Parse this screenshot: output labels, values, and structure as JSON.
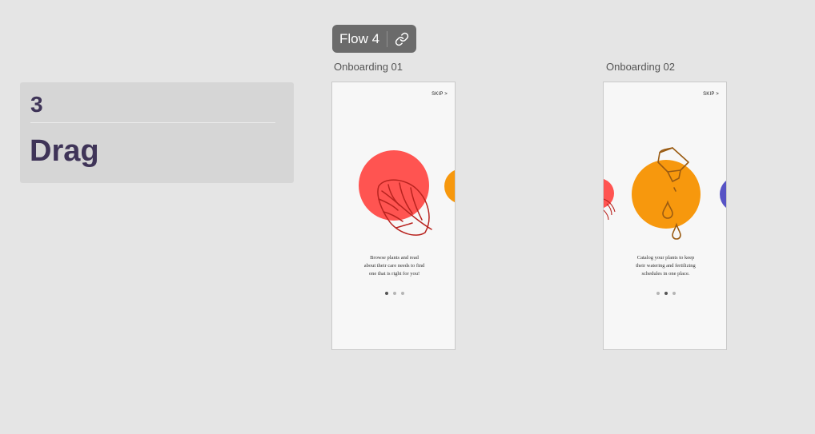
{
  "step_card": {
    "number": "3",
    "title": "Drag"
  },
  "flow": {
    "label": "Flow 4",
    "link_icon": "link-icon"
  },
  "frames": [
    {
      "label": "Onboarding 01",
      "skip": "SKIP >",
      "caption_lines": [
        "Browse plants and read",
        "about their care needs to find",
        "one that is right for you!"
      ],
      "dots": 3,
      "active_dot": 0,
      "main_circle_color": "#ff5451",
      "peek_circle_color": "#f7980d",
      "illustration": "monstera-leaf-icon",
      "illustration_color": "#b8231f"
    },
    {
      "label": "Onboarding 02",
      "skip": "SKIP >",
      "caption_lines": [
        "Catalog your plants to keep",
        "their watering and fertilizing",
        "schedules in one place."
      ],
      "dots": 3,
      "active_dot": 1,
      "main_circle_color": "#f7980d",
      "left_peek_circle_color": "#ff5451",
      "peek_circle_color": "#5753c5",
      "illustration": "watering-can-icon",
      "illustration_color": "#9a5b12"
    }
  ],
  "colors": {
    "canvas": "#e5e5e5",
    "step_text": "#3f3458",
    "badge": "#6b6b6b"
  }
}
